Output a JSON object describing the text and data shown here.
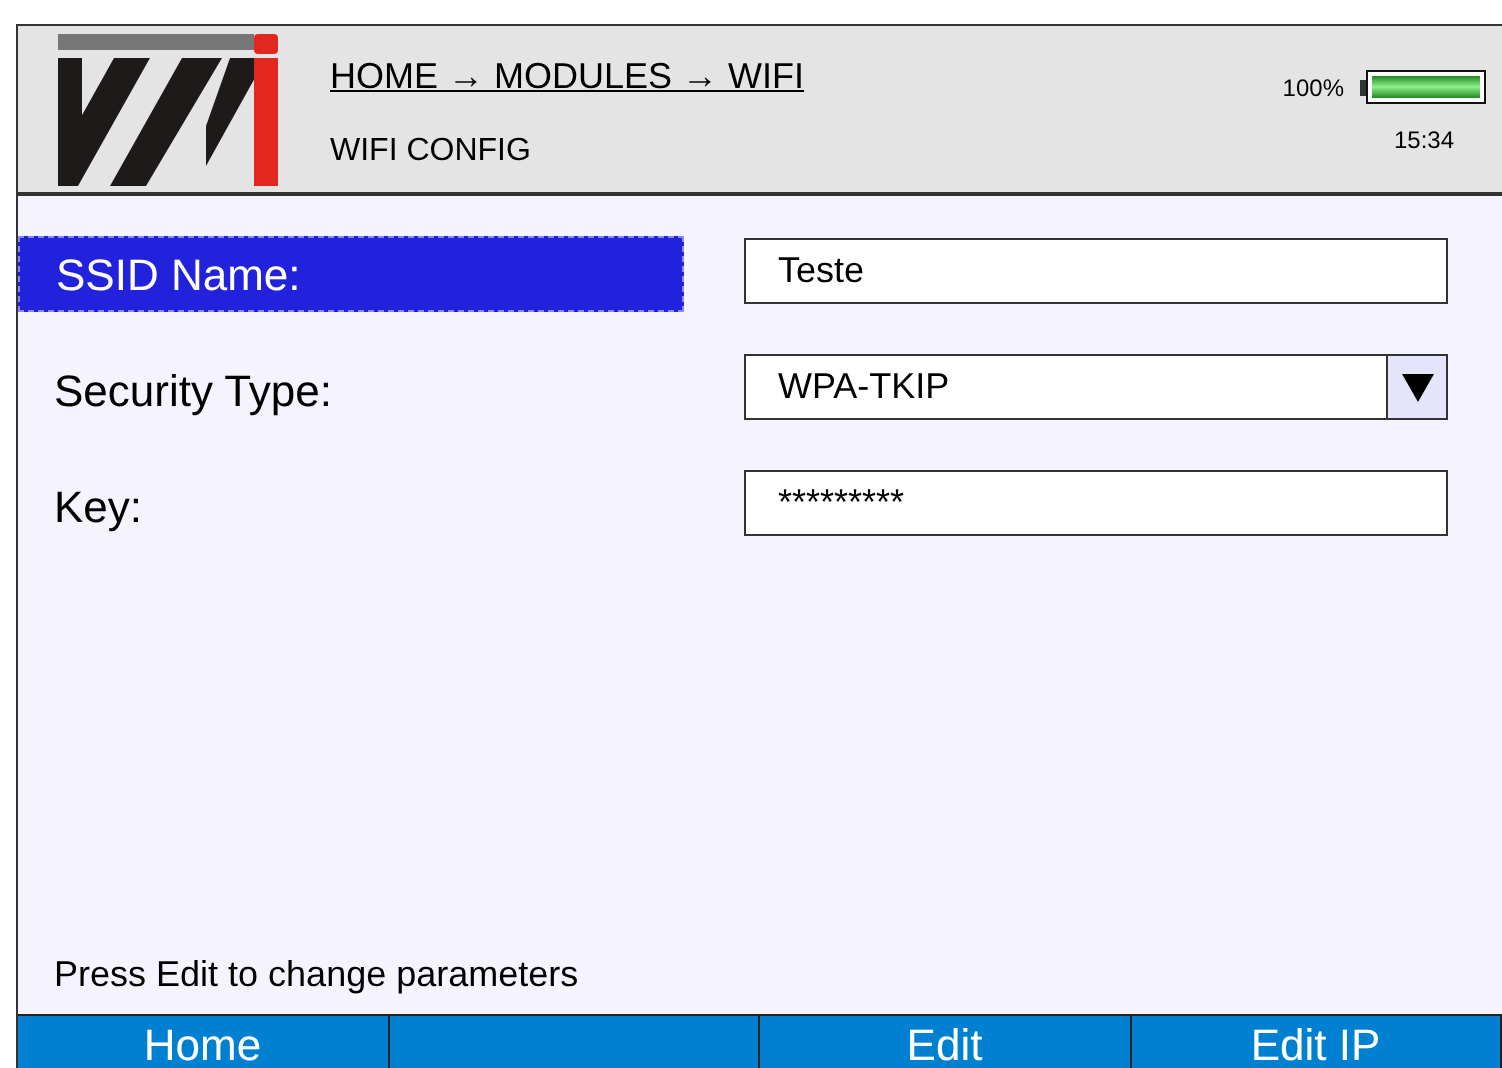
{
  "header": {
    "breadcrumb": "HOME → MODULES → WIFI",
    "title": "WIFI CONFIG",
    "battery": {
      "reading": "100%",
      "level": 1.0
    },
    "time": "15:34"
  },
  "fields": [
    {
      "label": "SSID Name:",
      "kind": "text",
      "value": "Teste",
      "selected": true
    },
    {
      "label": "Security Type:",
      "kind": "dropdown",
      "value": "WPA-TKIP",
      "selected": false
    },
    {
      "label": "Key:",
      "kind": "password",
      "value": "*********",
      "selected": false
    }
  ],
  "hint": "Press Edit to change parameters",
  "buttons": [
    {
      "kind": "button",
      "label": "Home"
    },
    {
      "kind": "blank"
    },
    {
      "kind": "button",
      "label": "Edit"
    },
    {
      "kind": "button",
      "label": "Edit IP"
    }
  ]
}
